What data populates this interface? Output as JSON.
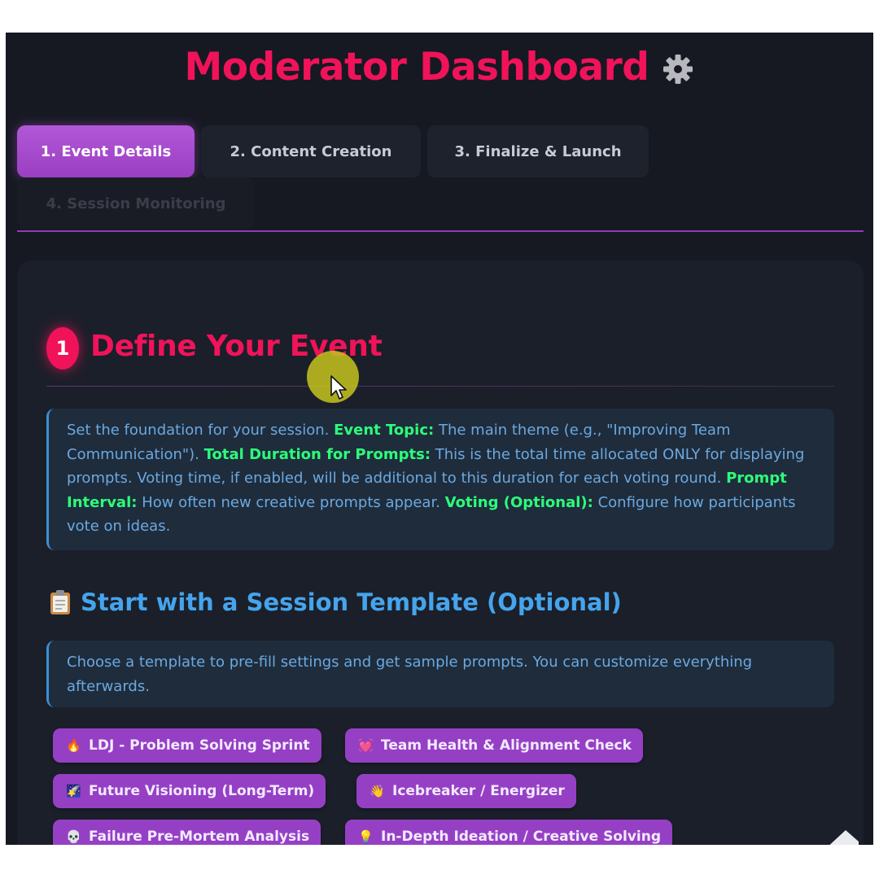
{
  "page": {
    "title": "Moderator Dashboard"
  },
  "tabs": [
    {
      "label": "1. Event Details",
      "state": "active"
    },
    {
      "label": "2. Content Creation",
      "state": "default"
    },
    {
      "label": "3. Finalize & Launch",
      "state": "default"
    },
    {
      "label": "4. Session Monitoring",
      "state": "disabled"
    }
  ],
  "section": {
    "step_number": "1",
    "title": "Define Your Event"
  },
  "info": {
    "intro": "Set the foundation for your session.",
    "topic_label": "Event Topic:",
    "topic_text": "The main theme (e.g., \"Improving Team Communication\").",
    "duration_label": "Total Duration for Prompts:",
    "duration_text": "This is the total time allocated ONLY for displaying prompts. Voting time, if enabled, will be additional to this duration for each voting round.",
    "interval_label": "Prompt Interval:",
    "interval_text": "How often new creative prompts appear.",
    "voting_label": "Voting (Optional):",
    "voting_text": "Configure how participants vote on ideas."
  },
  "templates": {
    "title": "Start with a Session Template (Optional)",
    "description": "Choose a template to pre-fill settings and get sample prompts. You can customize everything afterwards.",
    "items": [
      {
        "icon": "🔥",
        "label": "LDJ - Problem Solving Sprint"
      },
      {
        "icon": "💓",
        "label": "Team Health & Alignment Check"
      },
      {
        "icon": "🌠",
        "label": "Future Visioning (Long-Term)"
      },
      {
        "icon": "👋",
        "label": "Icebreaker / Energizer"
      },
      {
        "icon": "💀",
        "label": "Failure Pre-Mortem Analysis"
      },
      {
        "icon": "💡",
        "label": "In-Depth Ideation / Creative Solving"
      }
    ]
  },
  "colors": {
    "background": "#161922",
    "accent_pink": "#f0135a",
    "accent_purple": "#9540c4",
    "highlight_green": "#2cff7a",
    "info_blue": "#6aa9e0",
    "heading_blue": "#45a4ec"
  },
  "icons": {
    "title": "gear-icon",
    "templates": "clipboard-icon"
  }
}
